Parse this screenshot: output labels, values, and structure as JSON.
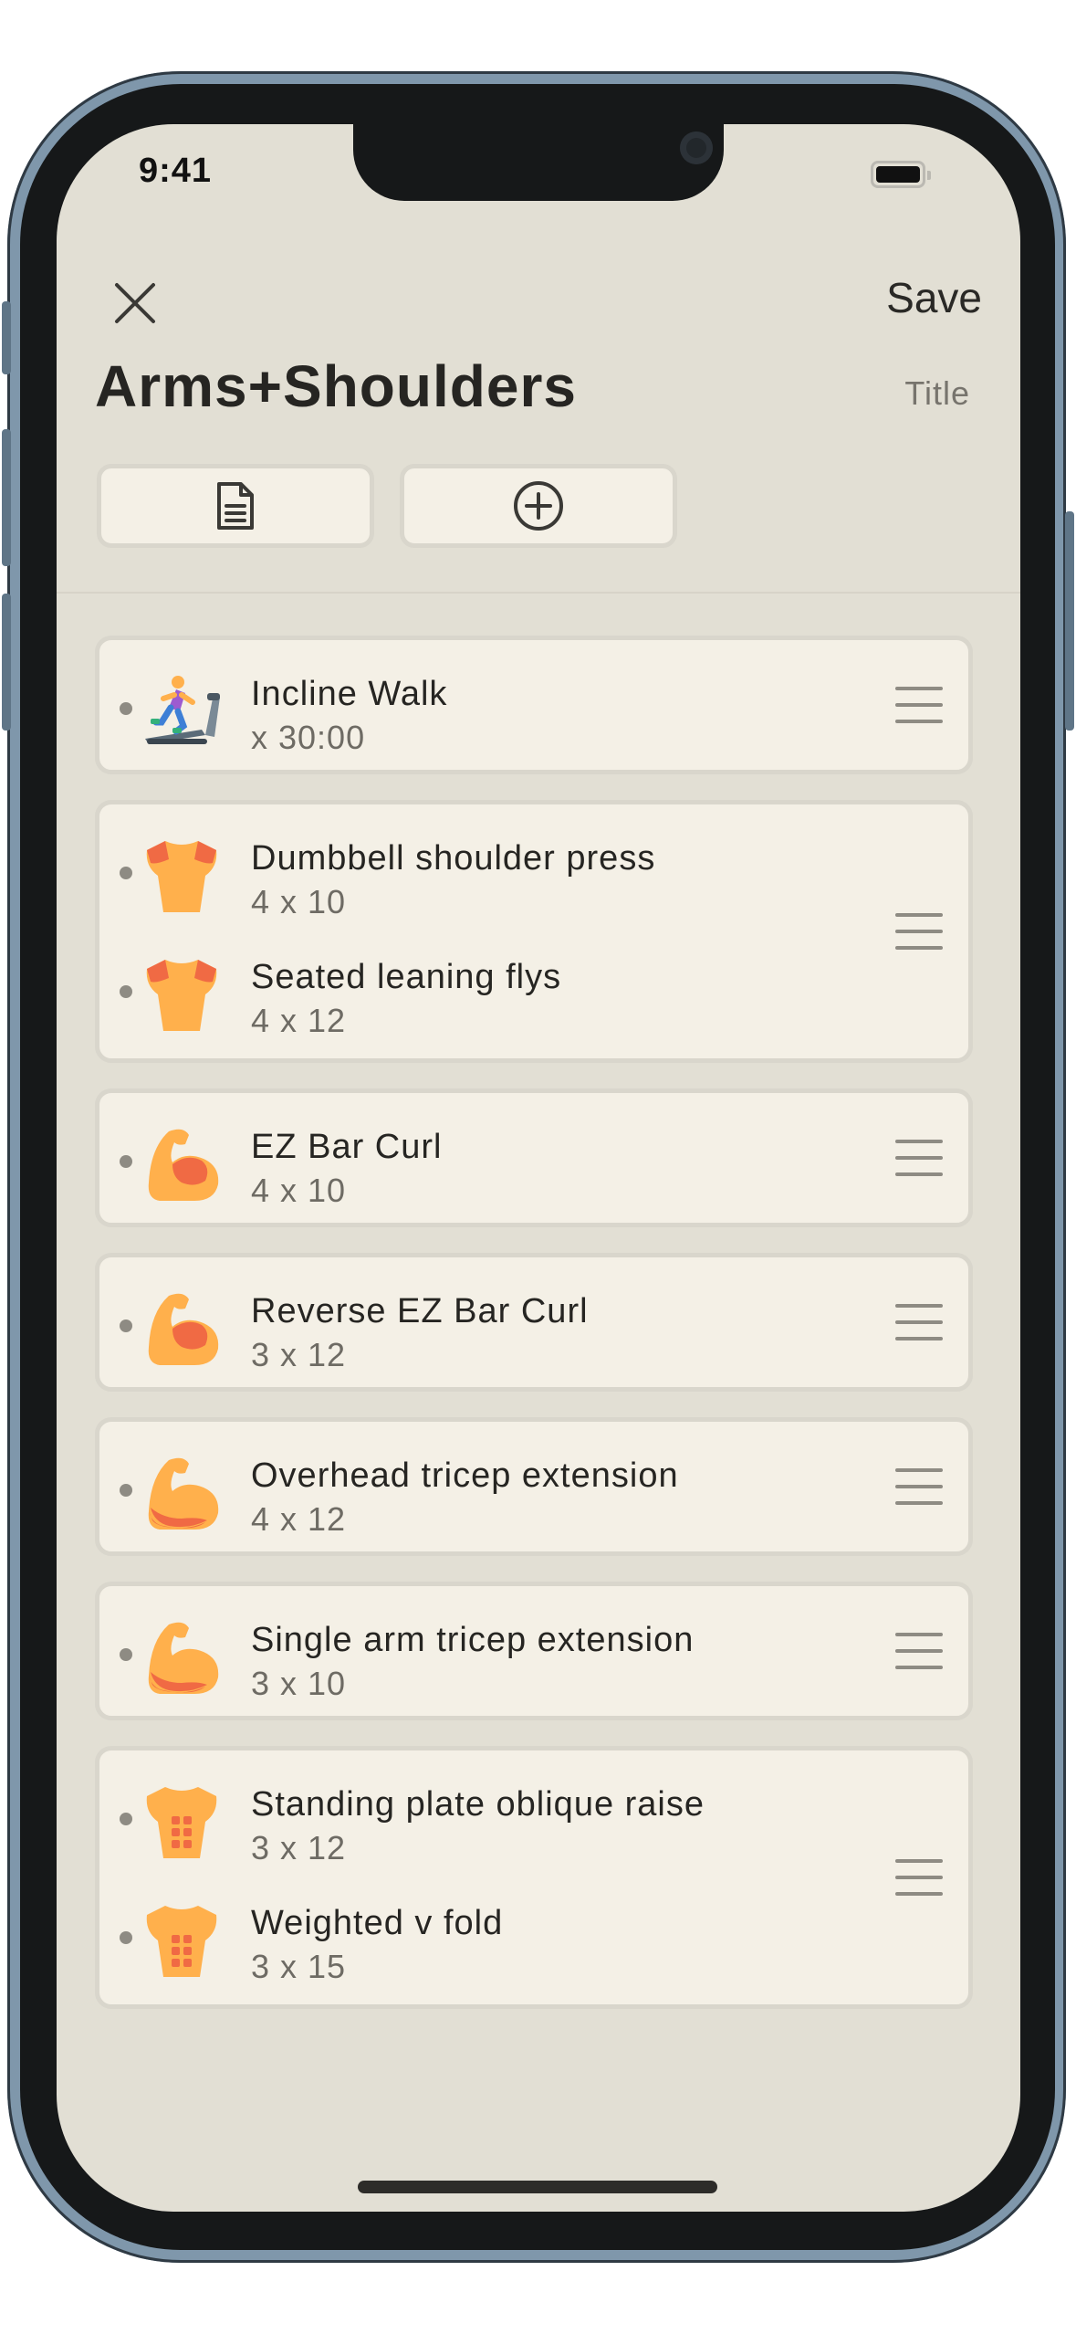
{
  "status": {
    "time": "9:41"
  },
  "header": {
    "close_icon": "close-icon",
    "save_label": "Save",
    "title": "Arms+Shoulders",
    "title_hint": "Title"
  },
  "toolbar": {
    "notes_icon": "document-icon",
    "add_icon": "plus-circle-icon"
  },
  "groups": [
    {
      "exercises": [
        {
          "name": "Incline Walk",
          "detail": "x 30:00",
          "icon": "treadmill-runner-icon"
        }
      ]
    },
    {
      "exercises": [
        {
          "name": "Dumbbell shoulder press",
          "detail": "4 x 10",
          "icon": "shoulders-torso-icon"
        },
        {
          "name": "Seated leaning flys",
          "detail": "4 x 12",
          "icon": "shoulders-torso-icon"
        }
      ]
    },
    {
      "exercises": [
        {
          "name": "EZ Bar Curl",
          "detail": "4 x 10",
          "icon": "biceps-arm-icon"
        }
      ]
    },
    {
      "exercises": [
        {
          "name": "Reverse EZ Bar Curl",
          "detail": "3 x 12",
          "icon": "biceps-arm-icon"
        }
      ]
    },
    {
      "exercises": [
        {
          "name": "Overhead tricep extension",
          "detail": "4 x 12",
          "icon": "triceps-arm-icon"
        }
      ]
    },
    {
      "exercises": [
        {
          "name": "Single arm tricep extension",
          "detail": "3 x 10",
          "icon": "triceps-arm-icon"
        }
      ]
    },
    {
      "exercises": [
        {
          "name": "Standing plate oblique raise",
          "detail": "3 x 12",
          "icon": "abs-torso-icon"
        },
        {
          "name": "Weighted v fold",
          "detail": "3 x 15",
          "icon": "abs-torso-icon"
        }
      ]
    }
  ],
  "colors": {
    "screen_bg": "#e2dfd4",
    "card_bg": "#f4f0e6",
    "card_border": "#d9d6cc",
    "muscle_base": "#ffb04c",
    "muscle_highlight": "#f06a44"
  }
}
